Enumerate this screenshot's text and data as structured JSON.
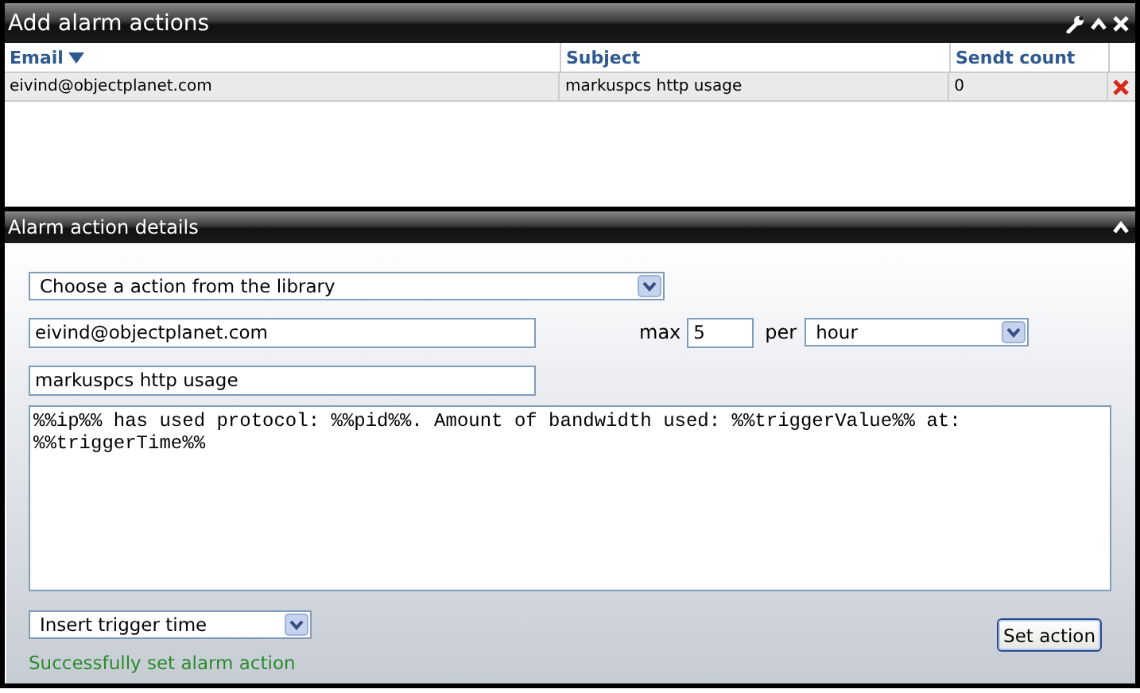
{
  "top_panel": {
    "title": "Add alarm actions",
    "table": {
      "columns": [
        {
          "label": "Email",
          "sorted": true
        },
        {
          "label": "Subject",
          "sorted": false
        },
        {
          "label": "Sendt count",
          "sorted": false
        }
      ],
      "rows": [
        {
          "cells": [
            "eivind@objectplanet.com",
            "markuspcs http usage",
            "0"
          ]
        }
      ]
    }
  },
  "details_panel": {
    "title": "Alarm action details",
    "library_dropdown": "Choose a action from the library",
    "email": "eivind@objectplanet.com",
    "max_label": "max",
    "max": "5",
    "per_label": "per",
    "per_dropdown": "hour",
    "subject": "markuspcs http usage",
    "message": "%%ip%% has used protocol: %%pid%%. Amount of bandwidth used: %%triggerValue%% at: %%triggerTime%%",
    "insert_dropdown": "Insert trigger time",
    "status": "Successfully set alarm action",
    "button": "Set action"
  }
}
